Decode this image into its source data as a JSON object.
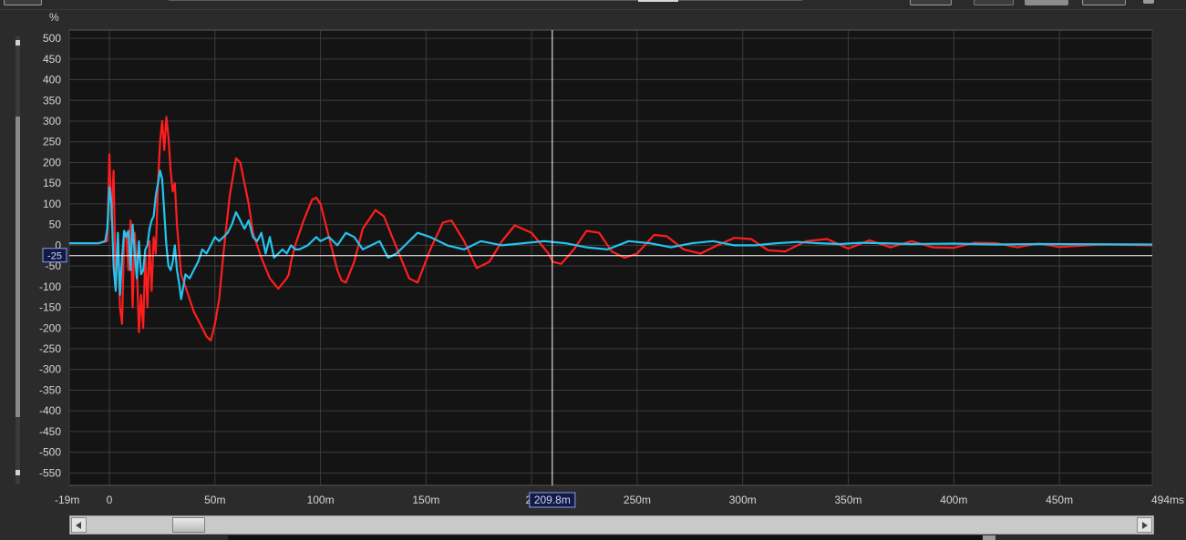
{
  "window": {
    "unit_label": "%"
  },
  "cursor": {
    "readout_y": "-25",
    "readout_x": "209.8m",
    "value_y": -25,
    "value_x": 209.8
  },
  "chart_data": {
    "type": "line",
    "title": "",
    "xlabel": "",
    "ylabel": "%",
    "xlim": [
      -19,
      494
    ],
    "ylim": [
      -580,
      520
    ],
    "grid": true,
    "yticks": [
      500,
      450,
      400,
      350,
      300,
      250,
      200,
      150,
      100,
      50,
      0,
      -50,
      -100,
      -150,
      -200,
      -250,
      -300,
      -350,
      -400,
      -450,
      -500,
      -550
    ],
    "ytick_labels": [
      "500",
      "450",
      "400",
      "350",
      "300",
      "250",
      "200",
      "150",
      "100",
      "50",
      "0",
      "-50",
      "-100",
      "-150",
      "-200",
      "-250",
      "-300",
      "-350",
      "-400",
      "-450",
      "-500",
      "-550"
    ],
    "xticks": [
      -19,
      0,
      50,
      100,
      150,
      200,
      250,
      300,
      350,
      400,
      450,
      494
    ],
    "xtick_labels": [
      "-19m",
      "0",
      "50m",
      "100m",
      "150m",
      "20",
      "250m",
      "300m",
      "350m",
      "400m",
      "450m",
      "494ms"
    ],
    "series": [
      {
        "color": "#ff1e1e",
        "x": [
          -19,
          -5,
          -1,
          0,
          1,
          2,
          3,
          4,
          5,
          6,
          7,
          8,
          9,
          10,
          11,
          12,
          13,
          14,
          15,
          16,
          17,
          18,
          19,
          20,
          21,
          22,
          23,
          24,
          25,
          26,
          27,
          28,
          29,
          30,
          31,
          32,
          34,
          36,
          38,
          40,
          42,
          44,
          46,
          48,
          50,
          52,
          54,
          57,
          60,
          62,
          64,
          66,
          68,
          72,
          76,
          80,
          84,
          85,
          86,
          88,
          92,
          96,
          98,
          100,
          104,
          108,
          110,
          112,
          116,
          120,
          126,
          130,
          134,
          138,
          142,
          146,
          152,
          158,
          162,
          168,
          174,
          180,
          186,
          192,
          200,
          208,
          210,
          214,
          220,
          226,
          232,
          238,
          244,
          250,
          258,
          264,
          272,
          280,
          288,
          296,
          304,
          312,
          320,
          330,
          340,
          350,
          360,
          370,
          380,
          390,
          400,
          410,
          420,
          430,
          440,
          450,
          470,
          494
        ],
        "y": [
          5,
          5,
          10,
          220,
          60,
          180,
          -100,
          20,
          -150,
          -190,
          20,
          30,
          -60,
          60,
          -150,
          30,
          -50,
          -210,
          -120,
          -200,
          -20,
          -150,
          10,
          -110,
          20,
          -20,
          150,
          250,
          300,
          230,
          310,
          260,
          180,
          130,
          150,
          50,
          -70,
          -100,
          -130,
          -160,
          -180,
          -200,
          -220,
          -230,
          -190,
          -130,
          -20,
          120,
          210,
          200,
          150,
          100,
          30,
          -30,
          -80,
          -105,
          -80,
          -70,
          -40,
          0,
          60,
          110,
          115,
          100,
          20,
          -60,
          -85,
          -90,
          -40,
          40,
          85,
          70,
          20,
          -30,
          -80,
          -90,
          -10,
          55,
          60,
          10,
          -55,
          -40,
          10,
          48,
          30,
          -20,
          -40,
          -45,
          -10,
          35,
          30,
          -15,
          -30,
          -20,
          25,
          22,
          -10,
          -20,
          0,
          18,
          15,
          -12,
          -15,
          10,
          15,
          -8,
          12,
          -5,
          10,
          -5,
          -6,
          6,
          5,
          -5,
          4,
          -4,
          2,
          0
        ]
      },
      {
        "color": "#25c3ef",
        "x": [
          -19,
          -5,
          -2,
          -1,
          0,
          1,
          2,
          3,
          4,
          5,
          6,
          7,
          8,
          9,
          10,
          11,
          12,
          13,
          14,
          15,
          16,
          17,
          18,
          19,
          20,
          21,
          22,
          23,
          24,
          25,
          26,
          27,
          28,
          29,
          30,
          31,
          32,
          33,
          34,
          35,
          36,
          38,
          40,
          42,
          44,
          46,
          48,
          50,
          52,
          54,
          56,
          58,
          60,
          62,
          64,
          66,
          68,
          70,
          72,
          74,
          76,
          78,
          80,
          82,
          84,
          86,
          88,
          90,
          94,
          98,
          100,
          104,
          108,
          112,
          116,
          120,
          124,
          128,
          132,
          136,
          140,
          146,
          152,
          160,
          168,
          176,
          186,
          196,
          206,
          216,
          226,
          236,
          246,
          256,
          266,
          276,
          286,
          296,
          306,
          316,
          326,
          336,
          346,
          356,
          366,
          380,
          400,
          420,
          440,
          494
        ],
        "y": [
          5,
          5,
          10,
          40,
          140,
          100,
          -50,
          -110,
          30,
          -120,
          -30,
          35,
          20,
          35,
          -60,
          50,
          -20,
          -80,
          10,
          -70,
          -60,
          -10,
          0,
          40,
          60,
          70,
          120,
          150,
          180,
          160,
          80,
          0,
          -50,
          -60,
          -40,
          0,
          -60,
          -90,
          -130,
          -100,
          -70,
          -80,
          -60,
          -40,
          -10,
          -20,
          0,
          20,
          10,
          20,
          30,
          50,
          80,
          60,
          40,
          60,
          20,
          10,
          30,
          -20,
          20,
          -30,
          -20,
          -10,
          -20,
          0,
          -10,
          -10,
          0,
          20,
          10,
          20,
          0,
          30,
          20,
          -10,
          0,
          10,
          -30,
          -20,
          0,
          30,
          20,
          0,
          -10,
          10,
          0,
          5,
          10,
          5,
          -5,
          -10,
          10,
          5,
          -5,
          5,
          10,
          0,
          0,
          5,
          8,
          5,
          3,
          6,
          5,
          3,
          4,
          2,
          3,
          2
        ]
      }
    ]
  }
}
